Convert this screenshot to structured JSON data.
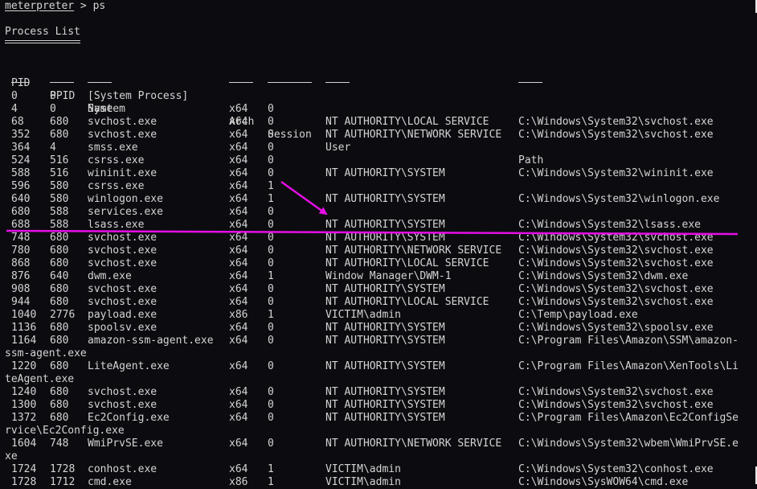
{
  "prompt": {
    "user": "meterpreter",
    "sep": " > ",
    "command": "ps"
  },
  "title": "Process List",
  "headers": {
    "pid": "PID",
    "ppid": "PPID",
    "name": "Name",
    "arch": "Arch",
    "session": "Session",
    "user": "User",
    "path": "Path"
  },
  "rows": [
    {
      "pid": "0",
      "ppid": "0",
      "name": "[System Process]",
      "arch": "",
      "session": "",
      "user": "",
      "path": ""
    },
    {
      "pid": "4",
      "ppid": "0",
      "name": "System",
      "arch": "x64",
      "session": "0",
      "user": "",
      "path": ""
    },
    {
      "pid": "68",
      "ppid": "680",
      "name": "svchost.exe",
      "arch": "x64",
      "session": "0",
      "user": "NT AUTHORITY\\LOCAL SERVICE",
      "path": "C:\\Windows\\System32\\svchost.exe"
    },
    {
      "pid": "352",
      "ppid": "680",
      "name": "svchost.exe",
      "arch": "x64",
      "session": "0",
      "user": "NT AUTHORITY\\NETWORK SERVICE",
      "path": "C:\\Windows\\System32\\svchost.exe"
    },
    {
      "pid": "364",
      "ppid": "4",
      "name": "smss.exe",
      "arch": "x64",
      "session": "0",
      "user": "",
      "path": ""
    },
    {
      "pid": "524",
      "ppid": "516",
      "name": "csrss.exe",
      "arch": "x64",
      "session": "0",
      "user": "",
      "path": ""
    },
    {
      "pid": "588",
      "ppid": "516",
      "name": "wininit.exe",
      "arch": "x64",
      "session": "0",
      "user": "NT AUTHORITY\\SYSTEM",
      "path": "C:\\Windows\\System32\\wininit.exe"
    },
    {
      "pid": "596",
      "ppid": "580",
      "name": "csrss.exe",
      "arch": "x64",
      "session": "1",
      "user": "",
      "path": ""
    },
    {
      "pid": "640",
      "ppid": "580",
      "name": "winlogon.exe",
      "arch": "x64",
      "session": "1",
      "user": "NT AUTHORITY\\SYSTEM",
      "path": "C:\\Windows\\System32\\winlogon.exe"
    },
    {
      "pid": "680",
      "ppid": "588",
      "name": "services.exe",
      "arch": "x64",
      "session": "0",
      "user": "",
      "path": ""
    },
    {
      "pid": "688",
      "ppid": "588",
      "name": "lsass.exe",
      "arch": "x64",
      "session": "0",
      "user": "NT AUTHORITY\\SYSTEM",
      "path": "C:\\Windows\\System32\\lsass.exe"
    },
    {
      "pid": "748",
      "ppid": "680",
      "name": "svchost.exe",
      "arch": "x64",
      "session": "0",
      "user": "NT AUTHORITY\\SYSTEM",
      "path": "C:\\Windows\\System32\\svchost.exe"
    },
    {
      "pid": "780",
      "ppid": "680",
      "name": "svchost.exe",
      "arch": "x64",
      "session": "0",
      "user": "NT AUTHORITY\\NETWORK SERVICE",
      "path": "C:\\Windows\\System32\\svchost.exe"
    },
    {
      "pid": "868",
      "ppid": "680",
      "name": "svchost.exe",
      "arch": "x64",
      "session": "0",
      "user": "NT AUTHORITY\\LOCAL SERVICE",
      "path": "C:\\Windows\\System32\\svchost.exe"
    },
    {
      "pid": "876",
      "ppid": "640",
      "name": "dwm.exe",
      "arch": "x64",
      "session": "1",
      "user": "Window Manager\\DWM-1",
      "path": "C:\\Windows\\System32\\dwm.exe"
    },
    {
      "pid": "908",
      "ppid": "680",
      "name": "svchost.exe",
      "arch": "x64",
      "session": "0",
      "user": "NT AUTHORITY\\SYSTEM",
      "path": "C:\\Windows\\System32\\svchost.exe"
    },
    {
      "pid": "944",
      "ppid": "680",
      "name": "svchost.exe",
      "arch": "x64",
      "session": "0",
      "user": "NT AUTHORITY\\LOCAL SERVICE",
      "path": "C:\\Windows\\System32\\svchost.exe"
    },
    {
      "pid": "1040",
      "ppid": "2776",
      "name": "payload.exe",
      "arch": "x86",
      "session": "1",
      "user": "VICTIM\\admin",
      "path": "C:\\Temp\\payload.exe"
    },
    {
      "pid": "1136",
      "ppid": "680",
      "name": "spoolsv.exe",
      "arch": "x64",
      "session": "0",
      "user": "NT AUTHORITY\\SYSTEM",
      "path": "C:\\Windows\\System32\\spoolsv.exe"
    },
    {
      "pid": "1164",
      "ppid": "680",
      "name": "amazon-ssm-agent.exe",
      "arch": "x64",
      "session": "0",
      "user": "NT AUTHORITY\\SYSTEM",
      "path": "C:\\Program Files\\Amazon\\SSM\\amazon-",
      "cont": "ssm-agent.exe"
    },
    {
      "pid": "1220",
      "ppid": "680",
      "name": "LiteAgent.exe",
      "arch": "x64",
      "session": "0",
      "user": "NT AUTHORITY\\SYSTEM",
      "path": "C:\\Program Files\\Amazon\\XenTools\\Li",
      "cont": "teAgent.exe"
    },
    {
      "pid": "1240",
      "ppid": "680",
      "name": "svchost.exe",
      "arch": "x64",
      "session": "0",
      "user": "NT AUTHORITY\\SYSTEM",
      "path": "C:\\Windows\\System32\\svchost.exe"
    },
    {
      "pid": "1300",
      "ppid": "680",
      "name": "svchost.exe",
      "arch": "x64",
      "session": "0",
      "user": "NT AUTHORITY\\SYSTEM",
      "path": "C:\\Windows\\System32\\svchost.exe"
    },
    {
      "pid": "1372",
      "ppid": "680",
      "name": "Ec2Config.exe",
      "arch": "x64",
      "session": "0",
      "user": "NT AUTHORITY\\SYSTEM",
      "path": "C:\\Program Files\\Amazon\\Ec2ConfigSe",
      "cont": "rvice\\Ec2Config.exe"
    },
    {
      "pid": "1604",
      "ppid": "748",
      "name": "WmiPrvSE.exe",
      "arch": "x64",
      "session": "0",
      "user": "NT AUTHORITY\\NETWORK SERVICE",
      "path": "C:\\Windows\\System32\\wbem\\WmiPrvSE.e",
      "cont": "xe"
    },
    {
      "pid": "1724",
      "ppid": "1728",
      "name": "conhost.exe",
      "arch": "x64",
      "session": "1",
      "user": "VICTIM\\admin",
      "path": "C:\\Windows\\System32\\conhost.exe"
    },
    {
      "pid": "1728",
      "ppid": "1712",
      "name": "cmd.exe",
      "arch": "x86",
      "session": "1",
      "user": "VICTIM\\admin",
      "path": "C:\\Windows\\SysWOW64\\cmd.exe"
    }
  ],
  "colors": {
    "background": "#0c0c10",
    "text": "#d4d4d4",
    "annotation": "#e60ee6"
  }
}
